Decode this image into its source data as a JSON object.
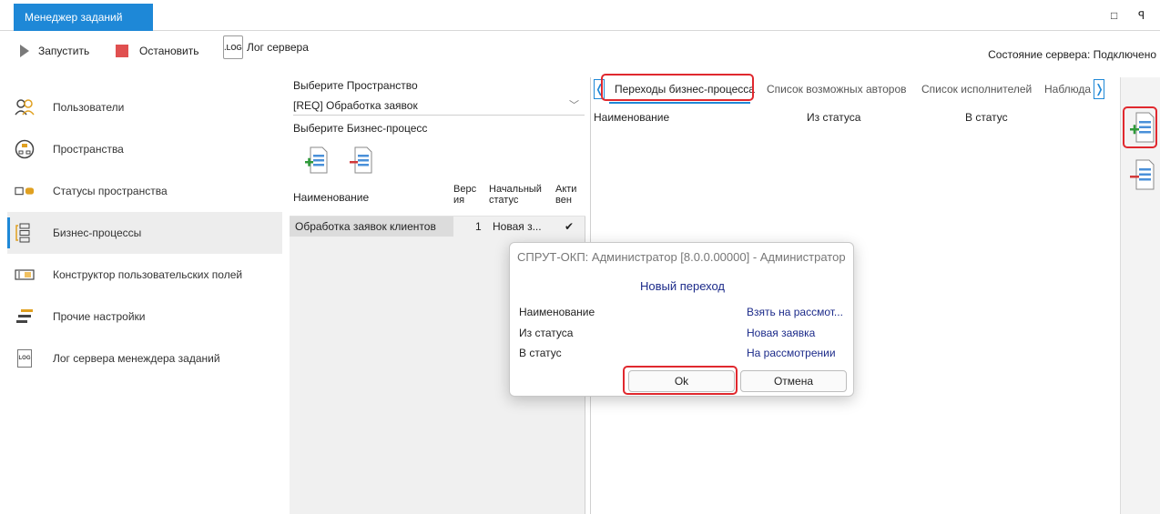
{
  "window": {
    "tab_title": "Менеджер заданий",
    "maximize_glyph": "□",
    "pin_glyph": "ꟼ"
  },
  "toolbar": {
    "start_label": "Запустить",
    "stop_label": "Остановить",
    "log_icon_text": ".LOG",
    "log_label": "Лог сервера",
    "server_status": "Состояние сервера: Подключено"
  },
  "sidebar": {
    "items": [
      {
        "label": "Пользователи",
        "icon": "users-icon"
      },
      {
        "label": "Пространства",
        "icon": "spaces-icon"
      },
      {
        "label": "Статусы пространства",
        "icon": "statuses-icon"
      },
      {
        "label": "Бизнес-процессы",
        "icon": "business-process-icon",
        "active": true
      },
      {
        "label": "Конструктор пользовательских полей",
        "icon": "field-constructor-icon"
      },
      {
        "label": "Прочие настройки",
        "icon": "settings-icon"
      },
      {
        "label": "Лог сервера менеждера заданий",
        "icon": "log-icon"
      }
    ],
    "log_icon_text": "LOG"
  },
  "middle": {
    "space_label": "Выберите Пространство",
    "space_value": "[REQ] Обработка заявок",
    "process_label": "Выберите Бизнес-процесс",
    "columns": [
      "Наименование",
      "Верс ия",
      "Начальный статус",
      "Акти вен"
    ],
    "rows": [
      {
        "name": "Обработка заявок клиентов",
        "version": "1",
        "start_status": "Новая з...",
        "active": "✔"
      }
    ]
  },
  "right": {
    "tabs": [
      "Переходы бизнес-процесса",
      "Список возможных авторов",
      "Список исполнителей",
      "Наблюда"
    ],
    "columns": [
      "Наименование",
      "Из статуса",
      "В статус"
    ]
  },
  "dialog": {
    "title": "СПРУТ-ОКП: Администратор [8.0.0.00000] - Администратор",
    "heading": "Новый переход",
    "fields": [
      {
        "label": "Наименование",
        "value": "Взять на рассмот..."
      },
      {
        "label": "Из статуса",
        "value": "Новая заявка"
      },
      {
        "label": "В статус",
        "value": "На рассмотрении"
      }
    ],
    "ok_label": "Ok",
    "cancel_label": "Отмена"
  },
  "colors": {
    "accent": "#1e88d7",
    "highlight": "#e0282e",
    "link": "#1c2b8a",
    "stop": "#e05050"
  }
}
